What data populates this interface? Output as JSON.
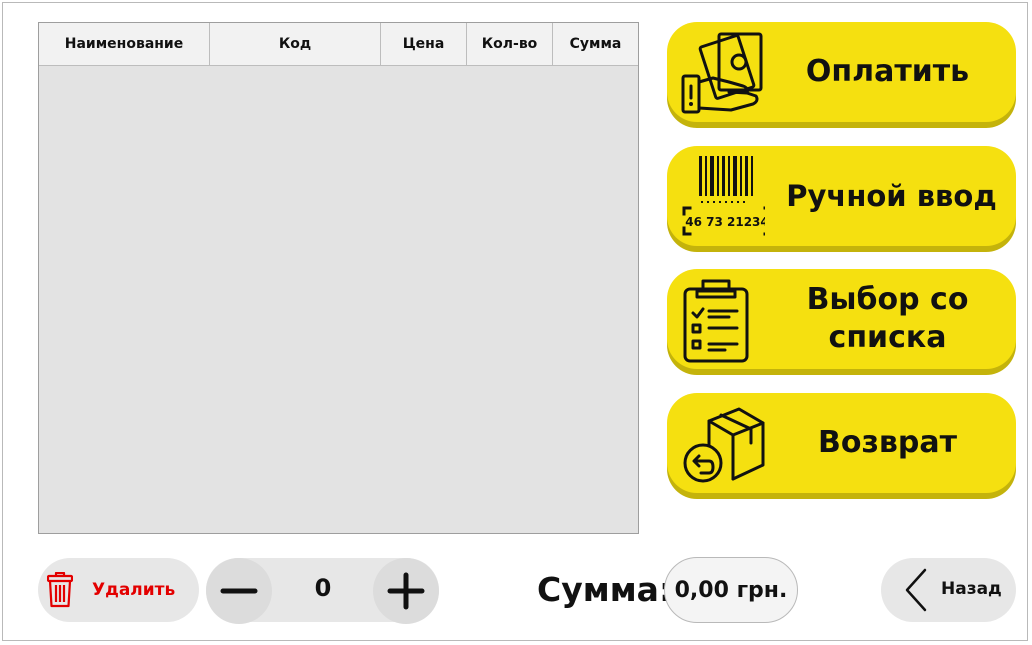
{
  "table": {
    "columns": [
      "Наименование",
      "Код",
      "Цена",
      "Кол-во",
      "Сумма"
    ],
    "rows": []
  },
  "actions": {
    "pay": "Оплатить",
    "manual_entry": "Ручной ввод",
    "manual_entry_barcode": "46 73 21234",
    "choose_from_list_line1": "Выбор со",
    "choose_from_list_line2": "списка",
    "return": "Возврат"
  },
  "footer": {
    "delete_label": "Удалить",
    "quantity": "0",
    "sum_label": "Сумма:",
    "sum_value": "0,00 грн.",
    "back_label": "Назад"
  },
  "colors": {
    "accent_yellow": "#f5e010",
    "delete_red": "#e30000",
    "table_bg": "#e3e3e3"
  }
}
